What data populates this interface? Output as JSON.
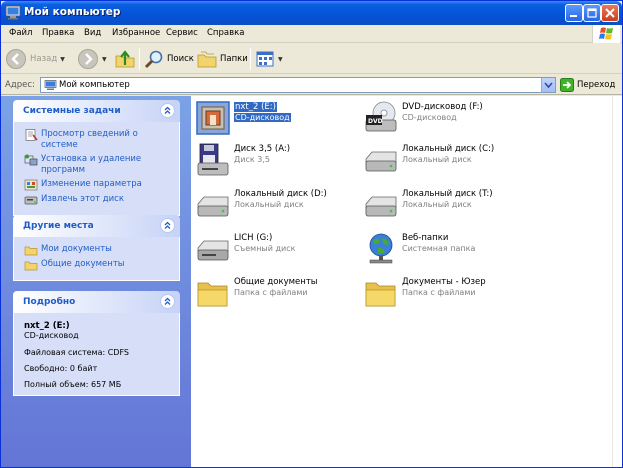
{
  "window": {
    "title": "Мой компьютер"
  },
  "menu": [
    "Файл",
    "Правка",
    "Вид",
    "Избранное",
    "Сервис",
    "Справка"
  ],
  "toolbar": {
    "back": "Назад",
    "search": "Поиск",
    "folders": "Папки"
  },
  "address": {
    "label": "Адрес:",
    "value": "Мой компьютер",
    "go": "Переход"
  },
  "system_tasks": {
    "title": "Системные задачи",
    "items": [
      "Просмотр сведений о системе",
      "Установка и удаление программ",
      "Изменение параметра",
      "Извлечь этот диск"
    ]
  },
  "other_places": {
    "title": "Другие места",
    "items": [
      "Мои документы",
      "Общие документы"
    ]
  },
  "details": {
    "title": "Подробно",
    "name": "nxt_2 (E:)",
    "type": "CD-дисковод",
    "fs": "Файловая система: CDFS",
    "free": "Свободно: 0 байт",
    "total": "Полный объем: 657 МБ"
  },
  "items": [
    {
      "name": "nxt_2 (E:)",
      "type": "CD-дисковод",
      "icon": "cd-drive-icon",
      "selected": true
    },
    {
      "name": "DVD-дисковод (F:)",
      "type": "CD-дисковод",
      "icon": "dvd-drive-icon"
    },
    {
      "name": "Диск 3,5 (A:)",
      "type": "Диск 3,5",
      "icon": "floppy-drive-icon"
    },
    {
      "name": "Локальный диск (C:)",
      "type": "Локальный диск",
      "icon": "hard-drive-icon"
    },
    {
      "name": "Локальный диск (D:)",
      "type": "Локальный диск",
      "icon": "hard-drive-icon"
    },
    {
      "name": "Локальный диск (T:)",
      "type": "Локальный диск",
      "icon": "hard-drive-icon"
    },
    {
      "name": "LICH (G:)",
      "type": "Съемный диск",
      "icon": "removable-drive-icon"
    },
    {
      "name": "Веб-папки",
      "type": "Системная папка",
      "icon": "web-folders-icon"
    },
    {
      "name": "Общие документы",
      "type": "Папка с файлами",
      "icon": "folder-icon"
    },
    {
      "name": "Документы - Юзер",
      "type": "Папка с файлами",
      "icon": "folder-icon"
    }
  ],
  "colors": {
    "titlebar": "#0553d8",
    "link": "#215dc6",
    "selection": "#316ac5"
  }
}
